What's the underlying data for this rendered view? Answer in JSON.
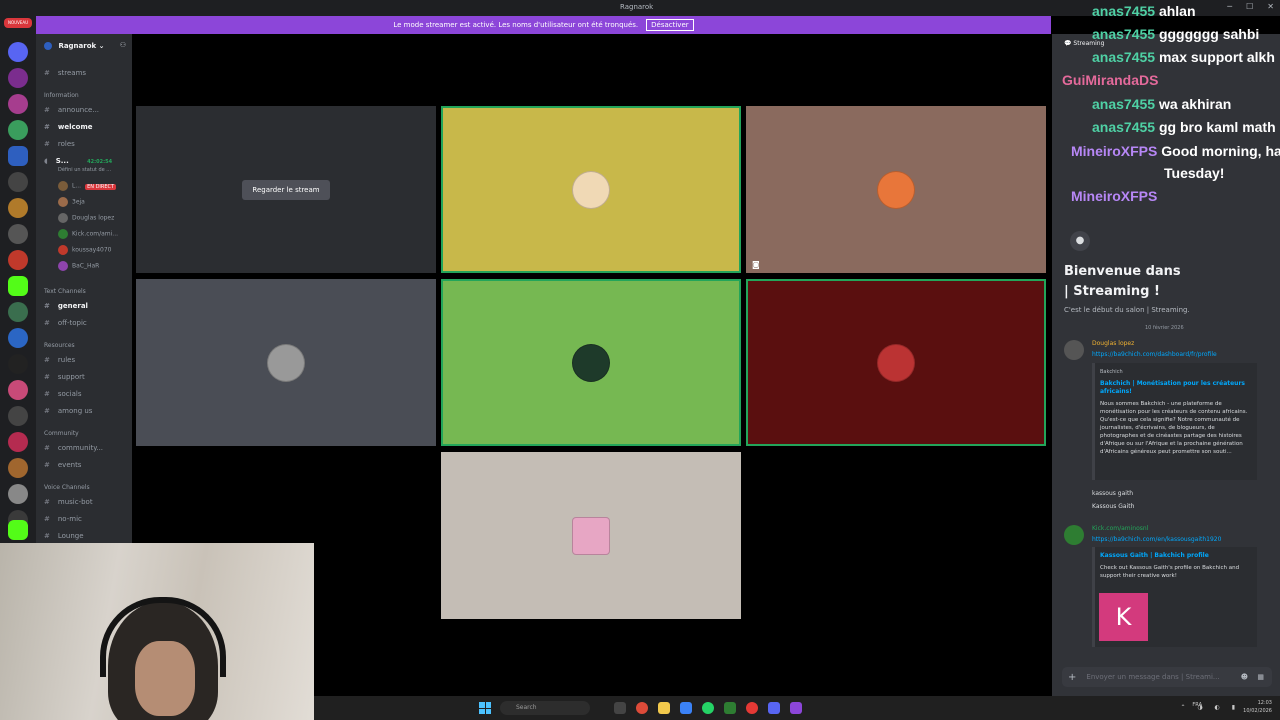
{
  "window": {
    "title": "Ragnarok"
  },
  "banner": {
    "text": "Le mode streamer est activé. Les noms d'utilisateur ont été tronqués.",
    "button": "Désactiver"
  },
  "rail": {
    "badge": "NOUVEAU"
  },
  "server": {
    "name": "Ragnarok"
  },
  "sidebar": {
    "streams": "streams",
    "cat_info": "Information",
    "announce": "announce...",
    "welcome": "welcome",
    "roles": "roles",
    "stream_channel": "S...",
    "stream_timer": "42:02:54",
    "stream_sub": "Défini un statut de ...",
    "voice_users": [
      {
        "name": "L...",
        "live": "EN DIRECT",
        "color": "#7a5c3a"
      },
      {
        "name": "3eja",
        "color": "#9b6b4a"
      },
      {
        "name": "Douglas lopez",
        "color": "#666"
      },
      {
        "name": "Kick.com/ami...",
        "color": "#2e7d32"
      },
      {
        "name": "koussay4070",
        "color": "#c0392b"
      },
      {
        "name": "BaC_HaR",
        "color": "#8e44ad"
      }
    ],
    "cat_text": "Text Channels",
    "general": "general",
    "offtopic": "off-topic",
    "cat_resources": "Resources",
    "rules": "rules",
    "support": "support",
    "socials": "socials",
    "among": "among us",
    "cat_community": "Community",
    "community": "community...",
    "events": "events",
    "cat_voice": "Voice Channels",
    "musicbot": "music-bot",
    "nomic": "no-mic",
    "lounge": "Lounge"
  },
  "grid": {
    "watch_label": "Regarder le stream",
    "tiles": [
      {
        "bg": "#c8b84a"
      },
      {
        "bg": "#8a6a5e"
      },
      {
        "bg": "#4a4d55"
      },
      {
        "bg": "#76b852"
      },
      {
        "bg": "#5a0f0f"
      },
      {
        "bg": "#c4bdb5"
      }
    ]
  },
  "overlay_chat": [
    {
      "user": "anas7455",
      "msg": "ahlan"
    },
    {
      "user": "anas7455",
      "msg": "ggggggg sahbi"
    },
    {
      "user": "anas7455",
      "msg": "max support alkh"
    },
    {
      "user": "GuiMirandaDS",
      "msg": ""
    },
    {
      "user": "anas7455",
      "msg": "wa akhiran"
    },
    {
      "user": "anas7455",
      "msg": "gg bro kaml math"
    },
    {
      "user": "MineiroXFPS",
      "msg": "Good morning, ha"
    },
    {
      "user": "",
      "msg": "Tuesday!"
    },
    {
      "user": "MineiroXFPS",
      "msg": ""
    }
  ],
  "chat": {
    "header": "Streaming",
    "welcome_line1": "Bienvenue dans",
    "welcome_line2": "| Streaming !",
    "sub": "C'est le début du salon | Streaming.",
    "date": "10 février 2026",
    "msg1_author": "Douglas lopez",
    "msg1_link": "https://ba9chich.com/dashboard/fr/profile",
    "embed1_site": "Bakchich",
    "embed1_title": "Bakchich | Monétisation pour les créateurs africains!",
    "embed1_desc": "Nous sommes Bakchich - une plateforme de monétisation pour les créateurs de contenu africains. Qu'est-ce que cela signifie? Notre communauté de journalistes, d'écrivains, de blogueurs, de photographes et de cinéastes partage des histoires d'Afrique ou sur l'Afrique et la prochaine génération d'Africains généreux peut promettre son souti...",
    "msg2_line1": "kassous gaith",
    "msg2_line2": "Kassous Gaith",
    "msg3_author": "Kick.com/aminosnl",
    "msg3_link": "https://ba9chich.com/en/kassousgaith1920",
    "embed2_title": "Kassous Gaith | Bakchich profile",
    "embed2_desc": "Check out Kassous Gaith's profile on Bakchich and support their creative work!",
    "embed2_letter": "K",
    "composer_placeholder": "Envoyer un message dans | Streami..."
  },
  "taskbar": {
    "search": "Search",
    "lang": "FRA",
    "time": "12:03",
    "date": "10/02/2026"
  }
}
